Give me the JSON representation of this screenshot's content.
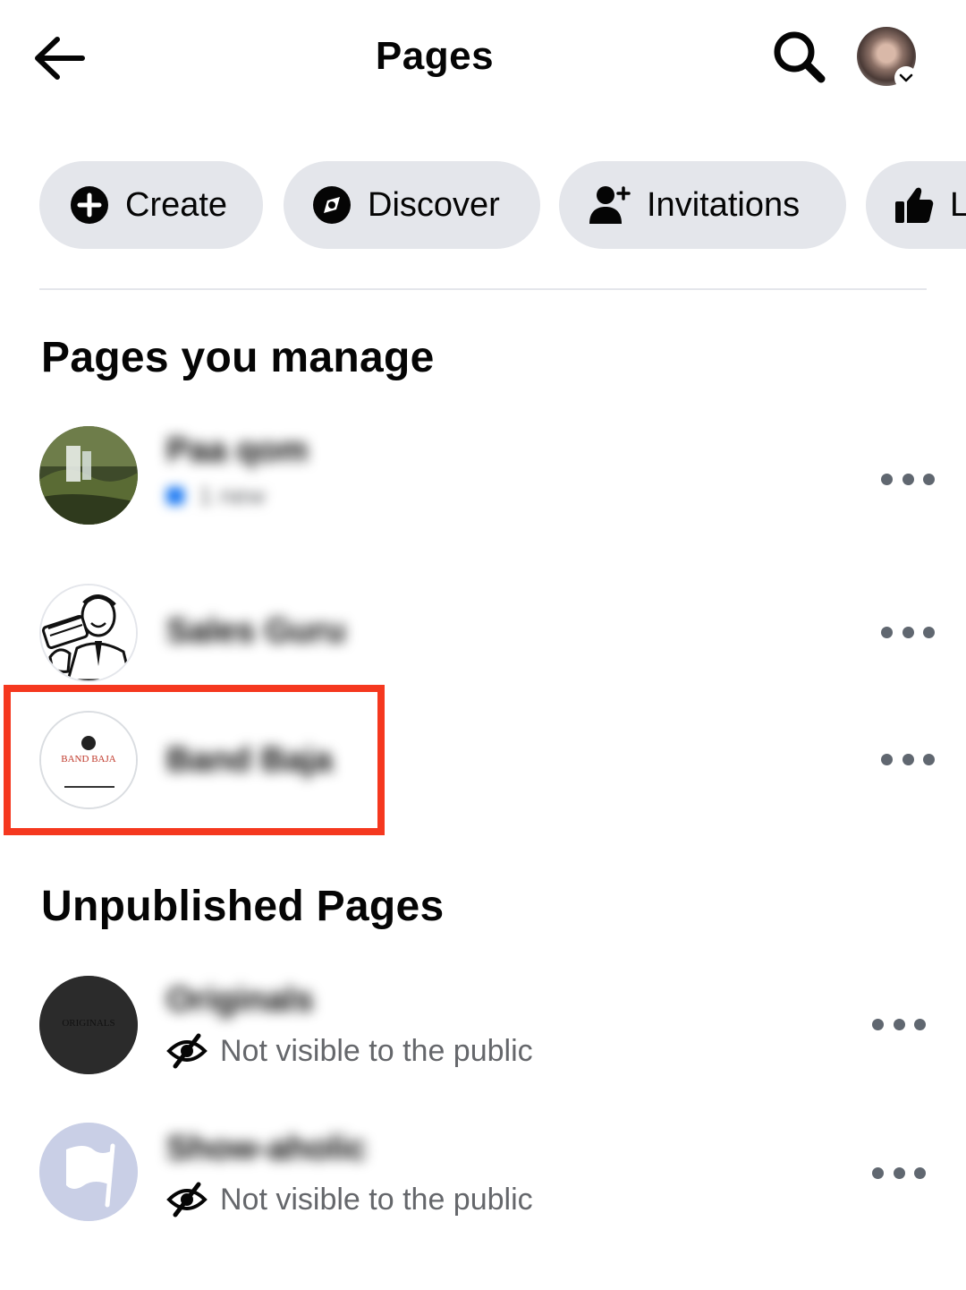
{
  "header": {
    "title": "Pages",
    "back_icon": "back-arrow-icon",
    "search_icon": "search-icon",
    "profile_icon": "profile-avatar"
  },
  "chips": [
    {
      "label": "Create",
      "icon": "plus-circle-icon"
    },
    {
      "label": "Discover",
      "icon": "compass-icon"
    },
    {
      "label": "Invitations",
      "icon": "add-person-icon"
    },
    {
      "label": "L",
      "icon": "thumbs-up-icon"
    }
  ],
  "sections": {
    "manage_title": "Pages you manage",
    "unpublished_title": "Unpublished Pages"
  },
  "managed_pages": [
    {
      "name": "Paa qom",
      "subtitle": "1 new",
      "avatar": "waterfall-forest-avatar"
    },
    {
      "name": "Sales Guru",
      "subtitle": "",
      "avatar": "vintage-salesman-illustration-avatar"
    },
    {
      "name": "Band Baja",
      "subtitle": "",
      "avatar": "band-baja-logo-avatar",
      "logo_text": "BAND BAJA",
      "highlighted": true
    }
  ],
  "unpublished_pages": [
    {
      "name": "Originals",
      "visibility": "Not visible to the public",
      "avatar": "originals-dark-avatar",
      "logo_text": "ORIGINALS"
    },
    {
      "name": "Show-aholic",
      "visibility": "Not visible to the public",
      "avatar": "flag-placeholder-avatar"
    }
  ],
  "colors": {
    "chip_bg": "#e4e6eb",
    "secondary_text": "#65676b",
    "highlight": "#f5381f",
    "accent": "#1877f2"
  }
}
